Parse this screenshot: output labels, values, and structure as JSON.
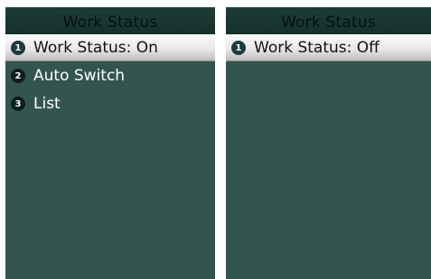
{
  "screens": [
    {
      "title": "Work Status",
      "items": [
        {
          "number": "1",
          "label": "Work Status: On",
          "selected": true
        },
        {
          "number": "2",
          "label": "Auto Switch",
          "selected": false
        },
        {
          "number": "3",
          "label": "List",
          "selected": false
        }
      ]
    },
    {
      "title": "Work Status",
      "items": [
        {
          "number": "1",
          "label": "Work Status: Off",
          "selected": true
        }
      ]
    }
  ],
  "colors": {
    "screen_background": "#335550",
    "titlebar_background": "#1a3632",
    "selected_highlight": "#e8e8e8",
    "badge": "#0d1d1b"
  }
}
